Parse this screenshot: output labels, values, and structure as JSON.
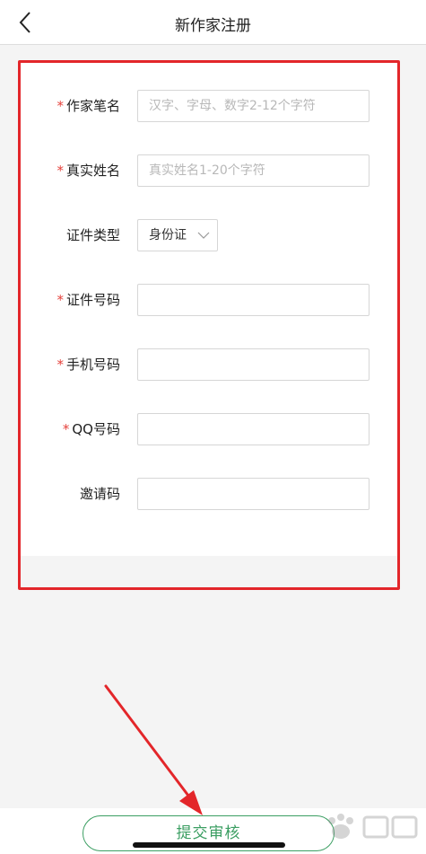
{
  "header": {
    "title": "新作家注册",
    "back_icon": "chevron-left-icon"
  },
  "form": {
    "pen_name": {
      "label": "作家笔名",
      "required_mark": "*",
      "placeholder": "汉字、字母、数字2-12个字符",
      "value": ""
    },
    "real_name": {
      "label": "真实姓名",
      "required_mark": "*",
      "placeholder": "真实姓名1-20个字符",
      "value": ""
    },
    "id_type": {
      "label": "证件类型",
      "selected": "身份证",
      "icon": "chevron-down-icon"
    },
    "id_number": {
      "label": "证件号码",
      "required_mark": "*",
      "value": ""
    },
    "phone": {
      "label": "手机号码",
      "required_mark": "*",
      "value": ""
    },
    "qq": {
      "label": "QQ号码",
      "required_mark": "*",
      "value": ""
    },
    "invite_code": {
      "label": "邀请码",
      "value": ""
    }
  },
  "footer": {
    "submit_label": "提交审核"
  },
  "colors": {
    "accent_green": "#3b9e62",
    "required_red": "#e5413b",
    "annotation_red": "#e3262a",
    "background": "#f4f4f4"
  },
  "annotations": {
    "highlight": "red-rectangle",
    "pointer": "red-arrow",
    "watermark": "watermark-logo"
  }
}
